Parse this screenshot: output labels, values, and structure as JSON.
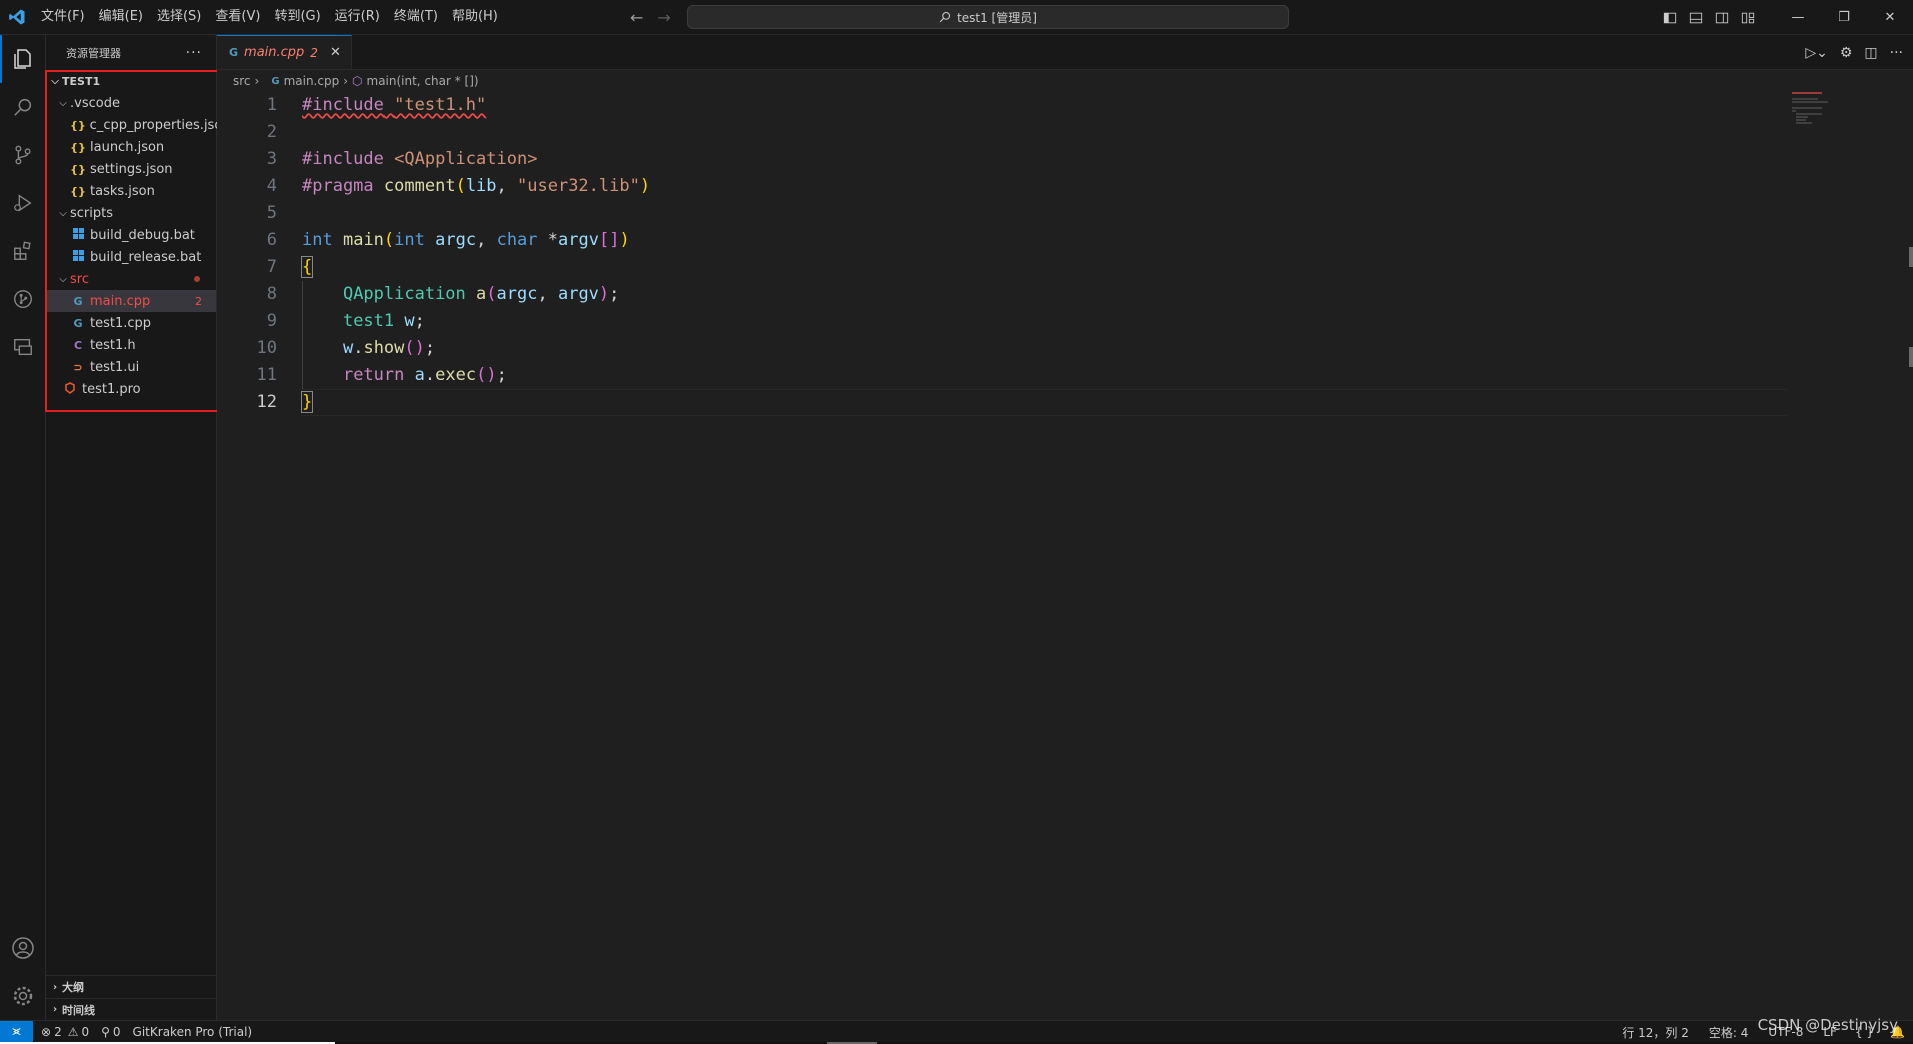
{
  "titlebar": {
    "menu": [
      "文件(F)",
      "编辑(E)",
      "选择(S)",
      "查看(V)",
      "转到(G)",
      "运行(R)",
      "终端(T)",
      "帮助(H)"
    ],
    "search_text": "test1 [管理员]"
  },
  "sidebar": {
    "title": "资源管理器",
    "more": "···",
    "root": "TEST1",
    "items": [
      {
        "label": ".vscode"
      },
      {
        "label": "c_cpp_properties.json",
        "icon": "{}"
      },
      {
        "label": "launch.json",
        "icon": "{}"
      },
      {
        "label": "settings.json",
        "icon": "{}"
      },
      {
        "label": "tasks.json",
        "icon": "{}"
      },
      {
        "label": "scripts"
      },
      {
        "label": "build_debug.bat"
      },
      {
        "label": "build_release.bat"
      },
      {
        "label": "src"
      },
      {
        "label": "main.cpp",
        "icon": "G",
        "badge": "2"
      },
      {
        "label": "test1.cpp",
        "icon": "G"
      },
      {
        "label": "test1.h",
        "icon": "C"
      },
      {
        "label": "test1.ui",
        "icon": "⊃"
      },
      {
        "label": "test1.pro"
      }
    ],
    "outline": "大纲",
    "timeline": "时间线"
  },
  "editor": {
    "tab_label": "main.cpp",
    "tab_problems": "2",
    "breadcrumb": {
      "folder": "src",
      "file": "main.cpp",
      "symbol": "main(int, char * [])"
    },
    "line_numbers": [
      "1",
      "2",
      "3",
      "4",
      "5",
      "6",
      "7",
      "8",
      "9",
      "10",
      "11",
      "12"
    ],
    "code": {
      "l1_directive": "#include",
      "l1_header": "\"test1.h\"",
      "l3_directive": "#include",
      "l3_header": "<QApplication>",
      "l4_directive": "#pragma",
      "l4_name": "comment",
      "l4_arg": "lib",
      "l4_str": "\"user32.lib\"",
      "l6_type": "int",
      "l6_fn": "main",
      "l6_p1type": "int",
      "l6_p1": "argc",
      "l6_p2type": "char",
      "l6_p2": "argv",
      "l8_type": "QApplication",
      "l8_fn": "a",
      "l8_a1": "argc",
      "l8_a2": "argv",
      "l9_type": "test1",
      "l9_var": "w",
      "l10_obj": "w",
      "l10_fn": "show",
      "l11_kw": "return",
      "l11_obj": "a",
      "l11_fn": "exec"
    }
  },
  "statusbar": {
    "errors": "2",
    "warnings": "0",
    "ports": "0",
    "gitkraken": "GitKraken Pro (Trial)",
    "position": "行 12，列 2",
    "spaces": "空格: 4",
    "encoding": "UTF-8",
    "eol": "LF"
  },
  "watermark": "CSDN @Destinyjsy"
}
